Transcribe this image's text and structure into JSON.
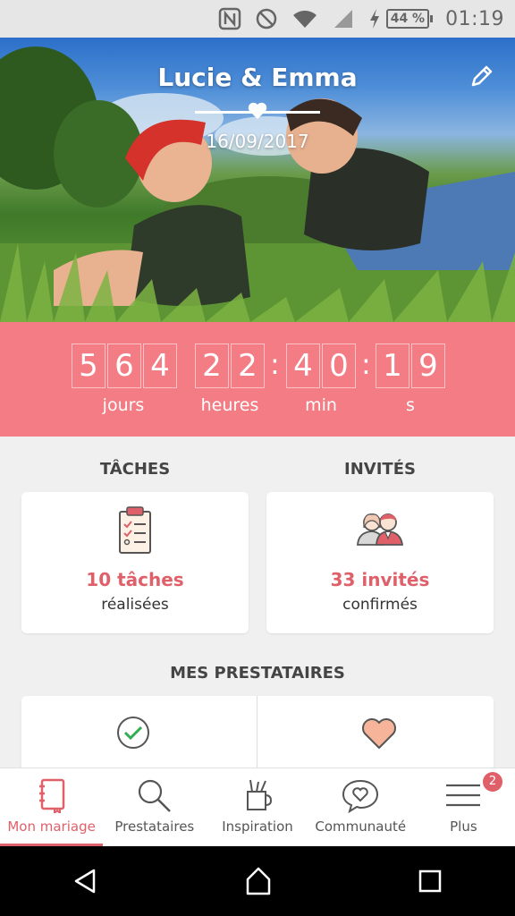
{
  "status_bar": {
    "icons": [
      "nfc-icon",
      "do-not-disturb-icon",
      "wifi-icon",
      "signal-icon",
      "charging-icon"
    ],
    "battery": "44 %",
    "time": "01:19"
  },
  "hero": {
    "title": "Lucie & Emma",
    "date": "16/09/2017"
  },
  "countdown": {
    "days": [
      "5",
      "6",
      "4"
    ],
    "hours": [
      "2",
      "2"
    ],
    "minutes": [
      "4",
      "0"
    ],
    "seconds": [
      "1",
      "9"
    ],
    "separator": ":",
    "labels": {
      "days": "jours",
      "hours": "heures",
      "minutes": "min",
      "seconds": "s"
    }
  },
  "tasks": {
    "title": "TÂCHES",
    "count": "10 tâches",
    "sub": "réalisées"
  },
  "guests": {
    "title": "INVITÉS",
    "count": "33 invités",
    "sub": "confirmés"
  },
  "vendors": {
    "title": "MES PRESTATAIRES"
  },
  "nav": {
    "items": [
      {
        "label": "Mon mariage",
        "icon": "notebook-icon"
      },
      {
        "label": "Prestataires",
        "icon": "search-icon"
      },
      {
        "label": "Inspiration",
        "icon": "pencil-cup-icon"
      },
      {
        "label": "Communauté",
        "icon": "chat-heart-icon"
      },
      {
        "label": "Plus",
        "icon": "menu-icon"
      }
    ],
    "badge": "2"
  },
  "colors": {
    "accent": "#e0606a",
    "countdown_bg": "#f47c84"
  }
}
